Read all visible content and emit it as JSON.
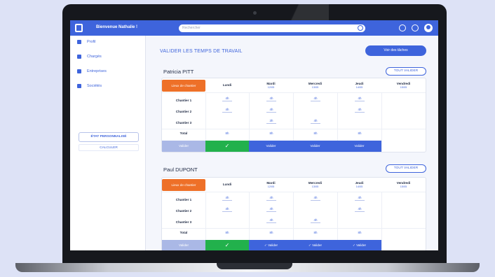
{
  "app": {
    "name": "Bienvenue Nathalie !",
    "search_placeholder": "Rechercher"
  },
  "sidebar": {
    "items": [
      {
        "label": "Profil",
        "icon": "user-icon"
      },
      {
        "label": "Chargés",
        "icon": "folder-icon"
      },
      {
        "label": "Entreprises",
        "icon": "document-icon"
      },
      {
        "label": "Sociétés",
        "icon": "tools-icon"
      }
    ],
    "primary_button": "ÉTAT PERSONNALISÉ",
    "secondary_button": "CALCULER"
  },
  "main": {
    "page_title": "VALIDER LES TEMPS DE TRAVAIL",
    "history_button": "Voir des tâches",
    "days": [
      {
        "day": "Lundi",
        "date": ""
      },
      {
        "day": "Mardi",
        "date": "12/05"
      },
      {
        "day": "Mercredi",
        "date": "13/05"
      },
      {
        "day": "Jeudi",
        "date": "14/05"
      },
      {
        "day": "Vendredi",
        "date": "15/05"
      }
    ],
    "employees": [
      {
        "name": "Patricia PITT",
        "validate_button": "TOUT VALIDER",
        "tag": "Lieux de chantier",
        "rows": [
          {
            "label": "Chantier 1",
            "values": [
              "4h",
              "4h",
              "4h",
              "4h",
              ""
            ]
          },
          {
            "label": "Chantier 2",
            "values": [
              "4h",
              "4h",
              "",
              "4h",
              ""
            ]
          },
          {
            "label": "Chantier 3",
            "values": [
              "",
              "3h",
              "4h",
              "",
              ""
            ]
          }
        ],
        "total_label": "Total",
        "totals": [
          "8h",
          "8h",
          "8h",
          "8h",
          ""
        ],
        "footer": [
          "Valider",
          "✓",
          "Valider",
          "Valider",
          "Valider",
          ""
        ]
      },
      {
        "name": "Paul DUPONT",
        "validate_button": "TOUT VALIDER",
        "tag": "Lieux de chantier",
        "rows": [
          {
            "label": "Chantier 1",
            "values": [
              "4h",
              "4h",
              "4h",
              "4h",
              ""
            ]
          },
          {
            "label": "Chantier 2",
            "values": [
              "4h",
              "4h",
              "",
              "4h",
              ""
            ]
          },
          {
            "label": "Chantier 3",
            "values": [
              "",
              "4h",
              "4h",
              "",
              ""
            ]
          }
        ],
        "total_label": "Total",
        "totals": [
          "8h",
          "8h",
          "8h",
          "8h",
          ""
        ],
        "footer": [
          "Valider",
          "✓",
          "✓ Valider",
          "✓ Valider",
          "✓ Valider",
          ""
        ]
      }
    ]
  },
  "colors": {
    "accent": "#3e64dc",
    "orange": "#ee7028",
    "green": "#22b14c",
    "validated_disabled": "#aab8e6"
  }
}
